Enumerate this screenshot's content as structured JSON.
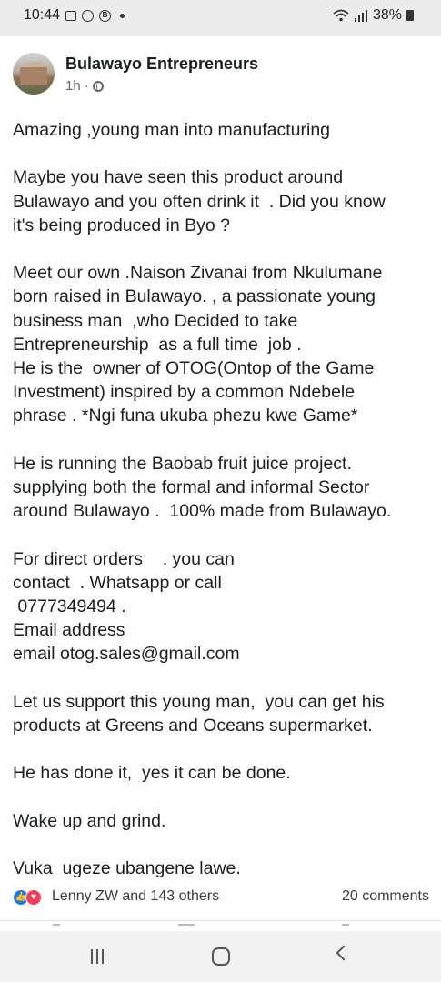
{
  "status_bar": {
    "time": "10:44",
    "battery": "38%",
    "icons": [
      "gallery-icon",
      "whatsapp-icon",
      "b-icon",
      "dot-icon",
      "wifi-icon",
      "signal-icon",
      "battery-icon"
    ]
  },
  "post": {
    "page_name": "Bulawayo Entrepreneurs",
    "time_ago": "1h ·",
    "body": "Amazing ,young man into manufacturing\n\nMaybe you have seen this product around\nBulawayo and you often drink it  . Did you know\nit's being produced in Byo ?\n\nMeet our own .Naison Zivanai from Nkulumane\nborn raised in Bulawayo. , a passionate young\nbusiness man  ,who Decided to take\nEntrepreneurship  as a full time  job .\nHe is the  owner of OTOG(Ontop of the Game\nInvestment) inspired by a common Ndebele\nphrase . *Ngi funa ukuba phezu kwe Game*\n\nHe is running the Baobab fruit juice project.\nsupplying both the formal and informal Sector\naround Bulawayo .  100% made from Bulawayo.\n\nFor direct orders    . you can\ncontact  . Whatsapp or call\n 0777349494 .\nEmail address\nemail otog.sales@gmail.com\n\nLet us support this young man,  you can get his\nproducts at Greens and Oceans supermarket.\n\nHe has done it,  yes it can be done.\n\nWake up and grind.\n\nVuka  ugeze ubangene lawe."
  },
  "reactions": {
    "text": "Lenny ZW and 143 others",
    "comments": "20 comments"
  },
  "colors": {
    "like": "#1877f2",
    "love": "#f33e58"
  }
}
